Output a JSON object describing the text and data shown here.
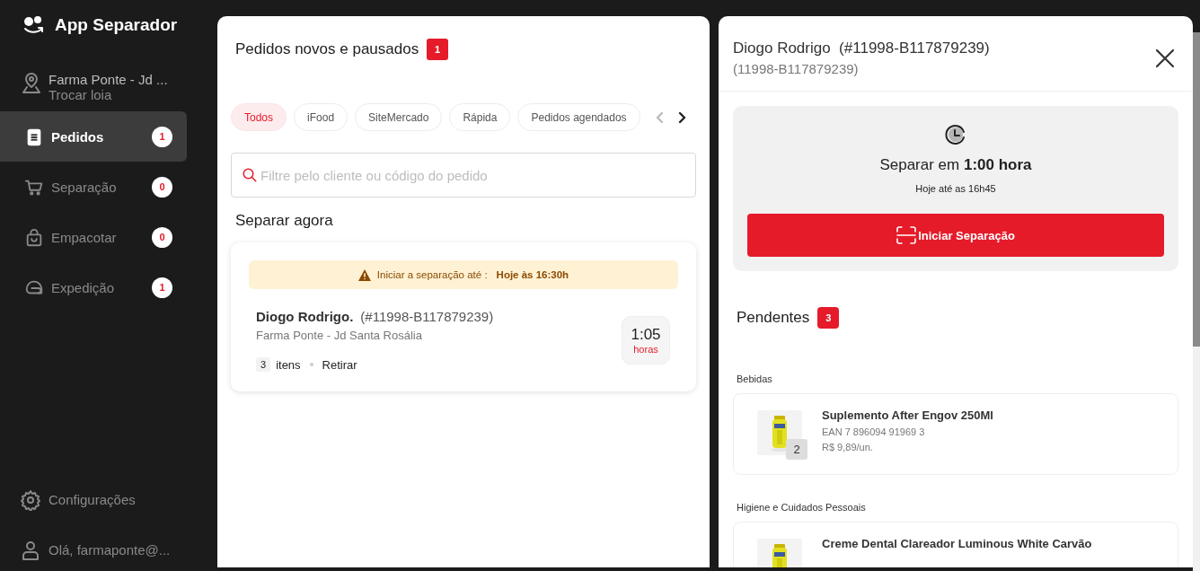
{
  "app": {
    "title": "App Separador"
  },
  "store": {
    "name": "Farma Ponte - Jd ...",
    "action": "Trocar loia"
  },
  "nav": [
    {
      "label": "Pedidos",
      "count": "1",
      "selected": true
    },
    {
      "label": "Separação",
      "count": "0",
      "selected": false
    },
    {
      "label": "Empacotar",
      "count": "0",
      "selected": false
    },
    {
      "label": "Expedição",
      "count": "1",
      "selected": false
    }
  ],
  "footer": [
    {
      "label": "Configurações"
    },
    {
      "label": "Olá, farmaponte@..."
    }
  ],
  "orders_panel": {
    "title": "Pedidos novos e pausados",
    "count": "1",
    "filters": [
      {
        "label": "Todos",
        "selected": true
      },
      {
        "label": "iFood",
        "selected": false
      },
      {
        "label": "SiteMercado",
        "selected": false
      },
      {
        "label": "Rápida",
        "selected": false
      },
      {
        "label": "Pedidos agendados",
        "selected": false
      }
    ],
    "search": {
      "placeholder": "Filtre pelo cliente ou código do pedido"
    },
    "section": "Separar agora",
    "orders": [
      {
        "alert": "Iniciar a separação até :",
        "deadline": "Hoje às 16:30h",
        "customer": "Diogo Rodrigo.",
        "code": "(#11998-B117879239)",
        "store": "Farma Ponte - Jd Santa Rosália",
        "items": "3",
        "items_label": "itens",
        "delivery": "Retirar",
        "time": "1:05",
        "time_unit": "horas"
      }
    ]
  },
  "detail": {
    "title": "Diogo Rodrigo  (#11998-B117879239)",
    "subtitle": "(11998-B117879239)",
    "timer": {
      "text": "Separar em **1:00 hora**",
      "note": "Hoje até as 16h45",
      "button": "Iniciar Separação"
    },
    "pending": {
      "title": "Pendentes",
      "count": "3"
    },
    "groups": [
      {
        "category": "Bebidas",
        "products": [
          {
            "name": "Suplemento After Engov 250Ml",
            "ean": "EAN 7 896094 91969 3",
            "price": "R$ 9,89/un.",
            "quantity": "2"
          }
        ]
      },
      {
        "category": "Higiene e Cuidados Pessoais",
        "products": [
          {
            "name": "Creme Dental Clareador Luminous White Carvão"
          }
        ]
      }
    ]
  }
}
